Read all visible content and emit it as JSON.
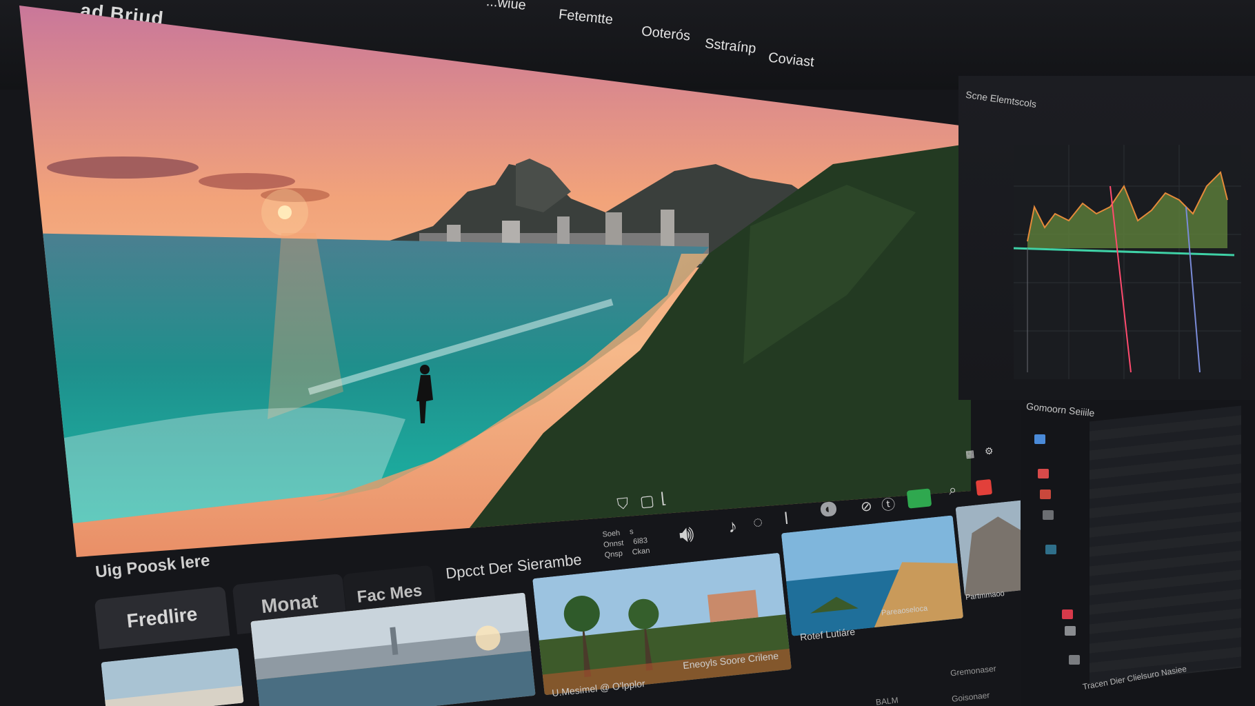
{
  "app": {
    "title": "...ad Briud"
  },
  "menu": {
    "items": [
      {
        "label": "...wiue"
      },
      {
        "label": "Fetemtte"
      },
      {
        "label": "Ooterós"
      },
      {
        "label": "Sstraínp"
      },
      {
        "label": "Coviast"
      }
    ]
  },
  "viewer": {
    "caption": "Uig Poosk lere"
  },
  "transport": {
    "readout_lines": [
      "Soeh",
      "Onnst",
      "Qnsp"
    ],
    "readout_values": [
      "s",
      "6l83",
      "Ckan"
    ]
  },
  "tabs": [
    {
      "label": "Fredlire"
    },
    {
      "label": "Monat"
    },
    {
      "label": "Fac Mes"
    },
    {
      "label": "Dpcct Der Sierambe"
    }
  ],
  "media": {
    "captions": [
      "U.Mesimel @ O'lpplor",
      "Eneoyls Soore Crilene",
      "Rotef Lutiáre",
      "Pareaoseloca",
      "Partmmaoo"
    ]
  },
  "scopes": {
    "title": "Scne Elemtscols"
  },
  "list_panel": {
    "title": "Gomoorn Seiiile"
  },
  "bottom": {
    "caption": "Tracen Dier Clielsuro Nasiee",
    "field_1": "Gremonaser",
    "field_2": "Goisonaer",
    "field_3": "BALM"
  },
  "colors": {
    "accent_green": "#2fa84f",
    "record_red": "#e2403a",
    "waveform_teal": "#3fd1a6",
    "waveform_red": "#ff4b6e"
  }
}
